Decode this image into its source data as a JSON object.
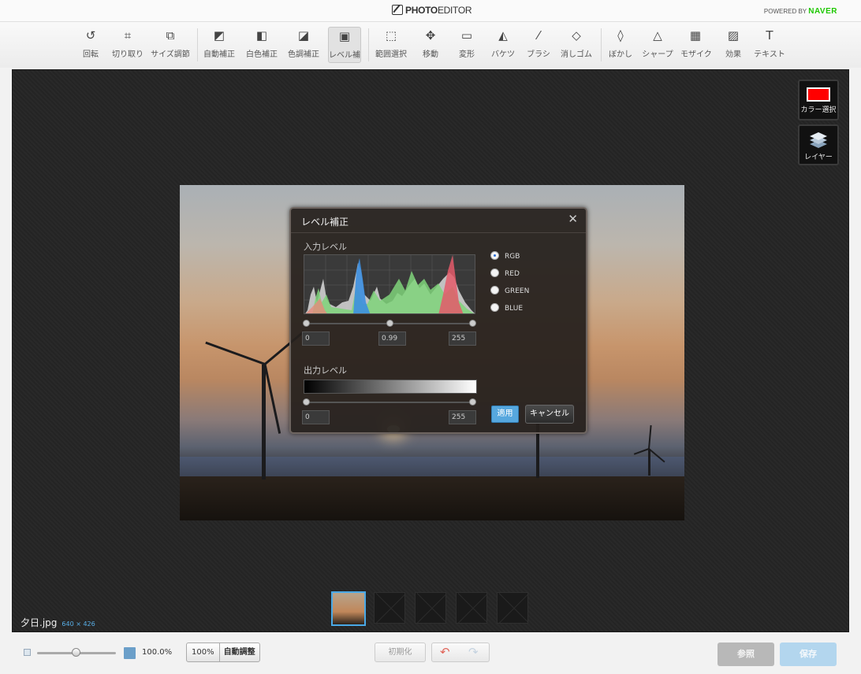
{
  "header": {
    "logo_bold": "PHOTO",
    "logo_light": "EDITOR",
    "powered_by": "POWERED BY",
    "brand": "NAVER"
  },
  "toolbar": {
    "tools": [
      {
        "label": "回転",
        "icon": "rotate-icon"
      },
      {
        "label": "切り取り",
        "icon": "crop-icon"
      },
      {
        "label": "サイズ調節",
        "icon": "resize-icon"
      },
      {
        "label": "自動補正",
        "icon": "auto-correct-icon"
      },
      {
        "label": "白色補正",
        "icon": "white-balance-icon"
      },
      {
        "label": "色調補正",
        "icon": "color-tone-icon"
      },
      {
        "label": "レベル補",
        "icon": "levels-icon"
      },
      {
        "label": "範囲選択",
        "icon": "marquee-icon"
      },
      {
        "label": "移動",
        "icon": "move-icon"
      },
      {
        "label": "変形",
        "icon": "transform-icon"
      },
      {
        "label": "バケツ",
        "icon": "bucket-icon"
      },
      {
        "label": "ブラシ",
        "icon": "brush-icon"
      },
      {
        "label": "消しゴム",
        "icon": "eraser-icon"
      },
      {
        "label": "ぼかし",
        "icon": "blur-icon"
      },
      {
        "label": "シャープ",
        "icon": "sharpen-icon"
      },
      {
        "label": "モザイク",
        "icon": "mosaic-icon"
      },
      {
        "label": "効果",
        "icon": "effect-icon"
      },
      {
        "label": "テキスト",
        "icon": "text-icon"
      }
    ]
  },
  "side_panel": {
    "color_label": "カラー選択",
    "layer_label": "レイヤー",
    "color": "#ff0000"
  },
  "dialog": {
    "title": "レベル補正",
    "input_label": "入力レベル",
    "output_label": "出力レベル",
    "input_values": {
      "black": "0",
      "gamma": "0.99",
      "white": "255"
    },
    "output_values": {
      "black": "0",
      "white": "255"
    },
    "channels": [
      "RGB",
      "RED",
      "GREEN",
      "BLUE"
    ],
    "selected_channel": "RGB",
    "apply_label": "適用",
    "cancel_label": "キャンセル"
  },
  "file": {
    "name": "夕日.jpg",
    "dims": "640 × 426"
  },
  "bottom": {
    "zoom_value": "100.0%",
    "btn_100": "100%",
    "btn_auto": "自動調整",
    "init_label": "初期化",
    "browse_label": "参照",
    "save_label": "保存"
  },
  "colors": {
    "accent": "#56a7de",
    "brand_green": "#1ec800"
  }
}
